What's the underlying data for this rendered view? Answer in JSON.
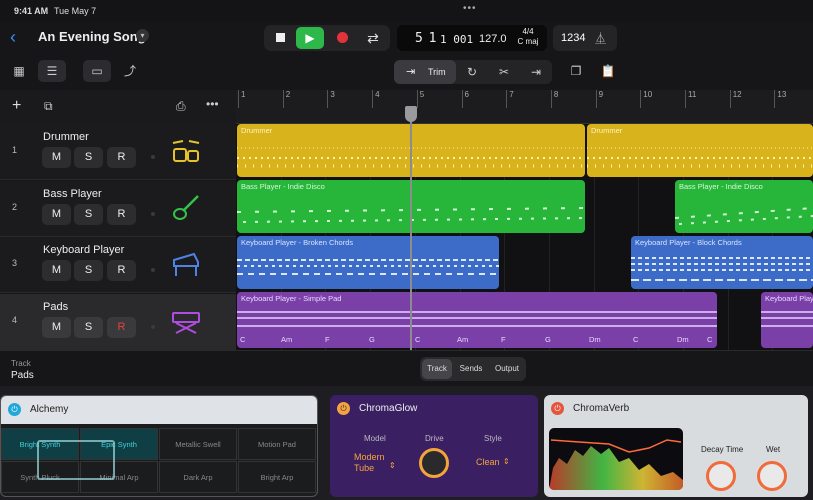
{
  "status": {
    "time": "9:41 AM",
    "date": "Tue May 7"
  },
  "header": {
    "song_title": "An Evening Song"
  },
  "lcd": {
    "position_bars": "5 1",
    "position_ticks": "1 001",
    "tempo": "127.0",
    "time_sig": "4/4",
    "key": "C maj"
  },
  "count_in": "1234",
  "edit": {
    "trim_label": "Trim"
  },
  "ruler": {
    "bars": [
      "1",
      "2",
      "3",
      "4",
      "5",
      "6",
      "7",
      "8",
      "9",
      "10",
      "11",
      "12",
      "13"
    ]
  },
  "tracks": [
    {
      "number": "1",
      "name": "Drummer",
      "mute": "M",
      "solo": "S",
      "rec": "R",
      "icon": "drum-kit-icon"
    },
    {
      "number": "2",
      "name": "Bass Player",
      "mute": "M",
      "solo": "S",
      "rec": "R",
      "icon": "bass-guitar-icon"
    },
    {
      "number": "3",
      "name": "Keyboard Player",
      "mute": "M",
      "solo": "S",
      "rec": "R",
      "icon": "piano-icon"
    },
    {
      "number": "4",
      "name": "Pads",
      "mute": "M",
      "solo": "S",
      "rec": "R",
      "icon": "synth-icon"
    }
  ],
  "regions": {
    "drummer_1": "Drummer",
    "drummer_2": "Drummer",
    "bass_1": "Bass Player - Indie Disco",
    "bass_2": "Bass Player - Indie Disco",
    "keys_1": "Keyboard Player - Broken Chords",
    "keys_2": "Keyboard Player - Block Chords",
    "pads_1": "Keyboard Player - Simple Pad",
    "pads_2": "Keyboard Play",
    "chords": [
      "C",
      "Am",
      "F",
      "G",
      "C",
      "Am",
      "F",
      "G",
      "Dm",
      "C",
      "Dm",
      "C"
    ]
  },
  "inspector": {
    "track_label": "Track",
    "track_value": "Pads",
    "tabs": [
      "Track",
      "Sends",
      "Output"
    ]
  },
  "plugins": {
    "alchemy": {
      "name": "Alchemy",
      "pads": [
        "Bright Synth",
        "Epic Synth",
        "Metallic Swell",
        "Motion Pad",
        "Synth Pluck",
        "Minimal Arp",
        "Dark Arp",
        "Bright Arp"
      ]
    },
    "chromaglow": {
      "name": "ChromaGlow",
      "model_label": "Model",
      "model_value_1": "Modern",
      "model_value_2": "Tube",
      "drive_label": "Drive",
      "style_label": "Style",
      "style_value": "Clean"
    },
    "chromaverb": {
      "name": "ChromaVerb",
      "decay_label": "Decay Time",
      "wet_label": "Wet"
    }
  },
  "colors": {
    "drummer": "#d8b31c",
    "bass": "#27b53a",
    "keys": "#3c6bc8",
    "pads": "#7b3fa8",
    "accent": "#f3a43b"
  }
}
